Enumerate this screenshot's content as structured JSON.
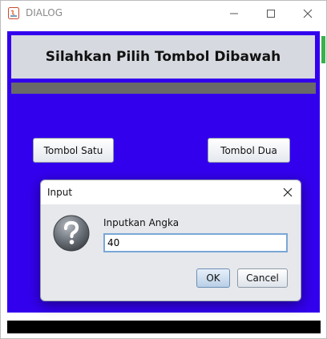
{
  "window": {
    "title": "DIALOG",
    "controls": {
      "minimize_icon": "minimize-icon",
      "maximize_icon": "maximize-icon",
      "close_icon": "close-icon"
    }
  },
  "main": {
    "header_title": "Silahkan Pilih Tombol Dibawah",
    "button_one": "Tombol Satu",
    "button_two": "Tombol Dua"
  },
  "dialog": {
    "title": "Input",
    "icon": "question-icon",
    "prompt": "Inputkan Angka",
    "input_value": "40",
    "ok_label": "OK",
    "cancel_label": "Cancel"
  },
  "colors": {
    "content_background": "#3300ee",
    "header_panel": "#d6d9df",
    "divider_bar": "#696969",
    "bottom_strip": "#000000"
  }
}
